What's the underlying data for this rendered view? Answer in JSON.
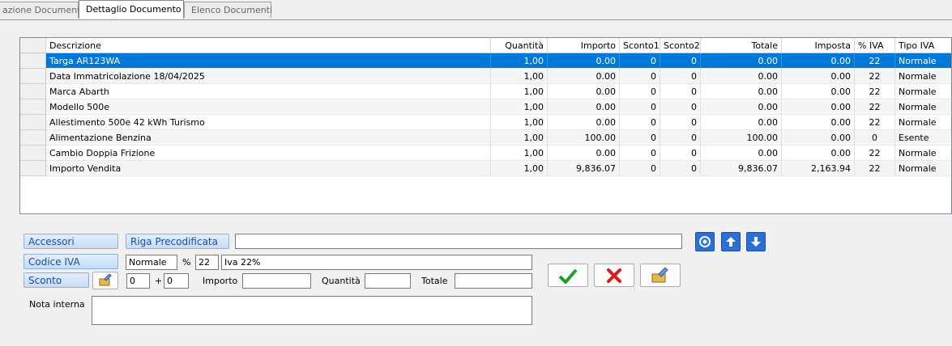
{
  "tabs": [
    "azione Documento",
    "Dettaglio Documento",
    "Elenco Documenti"
  ],
  "grid": {
    "columns": [
      "Descrizione",
      "Quantità",
      "Importo",
      "Sconto1",
      "Sconto2",
      "Totale",
      "Imposta",
      "% IVA",
      "Tipo IVA"
    ],
    "rows": [
      [
        "Targa AR123WA",
        "1,00",
        "0.00",
        "0",
        "0",
        "0.00",
        "0.00",
        "22",
        "Normale"
      ],
      [
        "Data Immatricolazione 18/04/2025",
        "1,00",
        "0.00",
        "0",
        "0",
        "0.00",
        "0.00",
        "22",
        "Normale"
      ],
      [
        "Marca Abarth",
        "1,00",
        "0.00",
        "0",
        "0",
        "0.00",
        "0.00",
        "22",
        "Normale"
      ],
      [
        "Modello 500e",
        "1,00",
        "0.00",
        "0",
        "0",
        "0.00",
        "0.00",
        "22",
        "Normale"
      ],
      [
        "Allestimento 500e 42 kWh Turismo",
        "1,00",
        "0.00",
        "0",
        "0",
        "0.00",
        "0.00",
        "22",
        "Normale"
      ],
      [
        "Alimentazione Benzina",
        "1,00",
        "100.00",
        "0",
        "0",
        "100.00",
        "0.00",
        "0",
        "Esente"
      ],
      [
        "Cambio Doppia Frizione",
        "1,00",
        "0.00",
        "0",
        "0",
        "0.00",
        "0.00",
        "22",
        "Normale"
      ],
      [
        "Importo Vendita",
        "1,00",
        "9,836.07",
        "0",
        "0",
        "9,836.07",
        "2,163.94",
        "22",
        "Normale"
      ]
    ]
  },
  "form": {
    "accessori_label": "Accessori",
    "riga_label": "Riga Precodificata",
    "riga_value": "",
    "codice_iva_label": "Codice IVA",
    "iva_tipo": "Normale",
    "percent_sign": "%",
    "iva_perc": "22",
    "iva_desc": "Iva 22%",
    "sconto_label": "Sconto",
    "sconto1": "0",
    "plus": "+",
    "sconto2": "0",
    "importo_label": "Importo",
    "importo_value": "",
    "quantita_label": "Quantità",
    "quantita_value": "",
    "totale_label": "Totale",
    "totale_value": "",
    "nota_label": "Nota interna",
    "nota_value": ""
  },
  "colors": {
    "selection": "#0078d7",
    "confirm": "#1e9e2a",
    "cancel": "#d81e1e",
    "nav": "#2b6fd6"
  }
}
